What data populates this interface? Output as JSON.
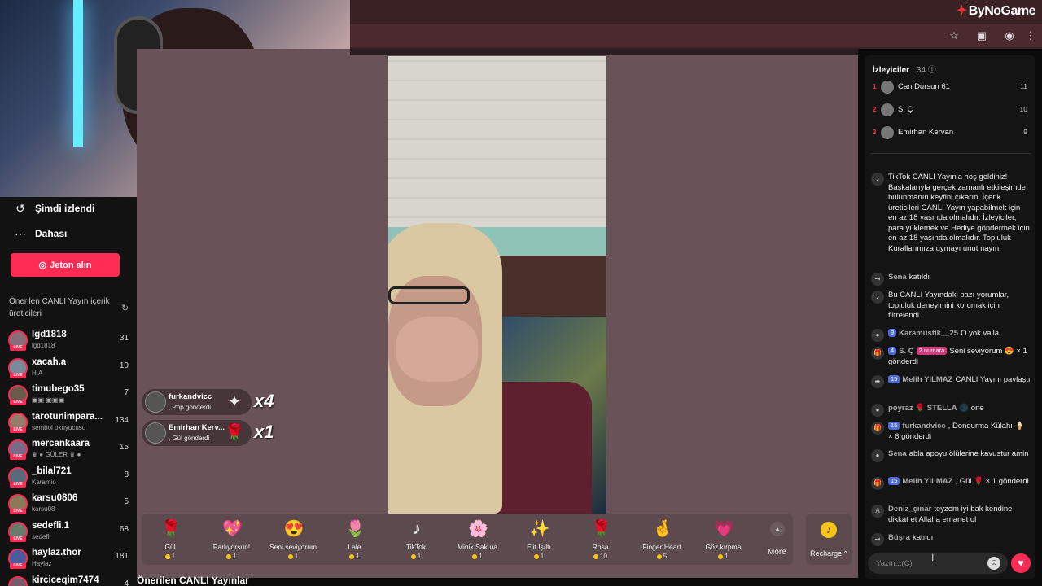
{
  "brand": {
    "logo_text": "ByNoGame"
  },
  "browser": {
    "icons": [
      "star-icon",
      "extensions-icon",
      "profile-icon",
      "menu-icon"
    ]
  },
  "sidebar": {
    "recent_label": "Şimdi izlendi",
    "more_label": "Dahası",
    "coin_button": "Jeton alın",
    "section_title": "Önerilen CANLI Yayın içerik üreticileri",
    "live_badge": "LIVE",
    "creators": [
      {
        "name": "lgd1818",
        "sub": "lgd1818",
        "count": "31"
      },
      {
        "name": "xacah.a",
        "sub": "H.A",
        "count": "10"
      },
      {
        "name": "timubego35",
        "sub": "▣▣ ▣▣▣",
        "count": "7"
      },
      {
        "name": "tarotunimpara...",
        "sub": "sembol okuyucusu",
        "count": "134"
      },
      {
        "name": "mercankaara",
        "sub": "♛ ● GÜLER ♛ ●",
        "count": "15"
      },
      {
        "name": "_bilal721",
        "sub": "Karamio",
        "count": "8"
      },
      {
        "name": "karsu0806",
        "sub": "karsu08",
        "count": "5"
      },
      {
        "name": "sedefli.1",
        "sub": "sedefli",
        "count": "68"
      },
      {
        "name": "haylaz.thor",
        "sub": "Haylaz",
        "count": "181"
      },
      {
        "name": "kirciceqim7474",
        "sub": "",
        "count": "4"
      }
    ]
  },
  "stage": {
    "gift_notifications": [
      {
        "name": "furkandvicc",
        "sub": ", Pop gönderdi",
        "multiplier": "x4",
        "gift_icon": "pop-gift-icon"
      },
      {
        "name": "Emirhan Kerv...",
        "sub": ", Gül gönderdi",
        "multiplier": "x1",
        "gift_icon": "rose-gift-icon"
      }
    ],
    "gifts": [
      {
        "name": "Gül",
        "price": "1",
        "icon": "🌹"
      },
      {
        "name": "Parlıyorsun!",
        "price": "1",
        "icon": "💖"
      },
      {
        "name": "Seni seviyorum",
        "price": "1",
        "icon": "😍"
      },
      {
        "name": "Lale",
        "price": "1",
        "icon": "🌷"
      },
      {
        "name": "TikTok",
        "price": "1",
        "icon": "♪"
      },
      {
        "name": "Minik Sakura",
        "price": "1",
        "icon": "🌸"
      },
      {
        "name": "Elit Işıltı",
        "price": "1",
        "icon": "✨"
      },
      {
        "name": "Rosa",
        "price": "10",
        "icon": "🌹"
      },
      {
        "name": "Finger Heart",
        "price": "5",
        "icon": "🤞"
      },
      {
        "name": "Göz kırpma",
        "price": "1",
        "icon": "💗"
      }
    ],
    "more_label": "More",
    "recharge_label": "Recharge ^",
    "suggested_title": "Önerilen CANLI Yayınlar"
  },
  "chat": {
    "viewers_title": "İzleyiciler",
    "viewers_count": "· 34 ⓘ",
    "top_viewers": [
      {
        "rank": "1",
        "name": "Can Dursun 61",
        "count": "11"
      },
      {
        "rank": "2",
        "name": "S. Ç",
        "count": "10"
      },
      {
        "rank": "3",
        "name": "Emirhan Kervan",
        "count": "9"
      }
    ],
    "messages": [
      {
        "icon": "♪",
        "user": "",
        "badge": "",
        "text": "TikTok CANLI Yayın'a hoş geldiniz! Başkalarıyla gerçek zamanlı etkileşimde bulunmanın keyfini çıkarın. İçerik üreticileri CANLI Yayın yapabilmek için en az 18 yaşında olmalıdır. İzleyiciler, para yüklemek ve Hediye göndermek için en az 18 yaşında olmalıdır. Topluluk Kurallarımıza uymayı unutmayın."
      },
      {
        "icon": "⇥",
        "user": "Sena",
        "badge": "",
        "text": "katıldı"
      },
      {
        "icon": "♪",
        "user": "",
        "badge": "",
        "text": "Bu CANLI Yayındaki bazı yorumlar, topluluk deneyimini korumak için filtrelendi."
      },
      {
        "icon": "●",
        "user": "Karamustik__25",
        "badge": "9",
        "text": "O yok valla"
      },
      {
        "icon": "🎁",
        "user": "S. Ç",
        "badge": "4",
        "text": "Seni seviyorum 😍 × 1 gönderdi"
      },
      {
        "icon": "➦",
        "user": "Melih YILMAZ",
        "badge": "15",
        "text": "CANLI Yayını paylaştı"
      },
      {
        "icon": "●",
        "user": "poyraz 🌹 STELLA 🌑",
        "badge": "",
        "text": "one"
      },
      {
        "icon": "🎁",
        "user": "furkandvicc",
        "badge": "15",
        "text": ", Dondurma Külahı 🍦 × 6 gönderdi"
      },
      {
        "icon": "●",
        "user": "Sena",
        "badge": "",
        "text": "abla apoyu ölülerine kavustur amin"
      },
      {
        "icon": "🎁",
        "user": "Melih YILMAZ",
        "badge": "15",
        "text": ", Gül 🌹 × 1 gönderdi"
      },
      {
        "icon": "A",
        "user": "Deniz_çınar",
        "badge": "",
        "text": "teyzem iyi bak kendine dikkat et Allaha emanet ol"
      },
      {
        "icon": "⇥",
        "user": "Büşra",
        "badge": "",
        "text": "katıldı"
      }
    ],
    "s_c_extra_badge": "2 numara",
    "input_placeholder": "Yazın...(C)"
  }
}
